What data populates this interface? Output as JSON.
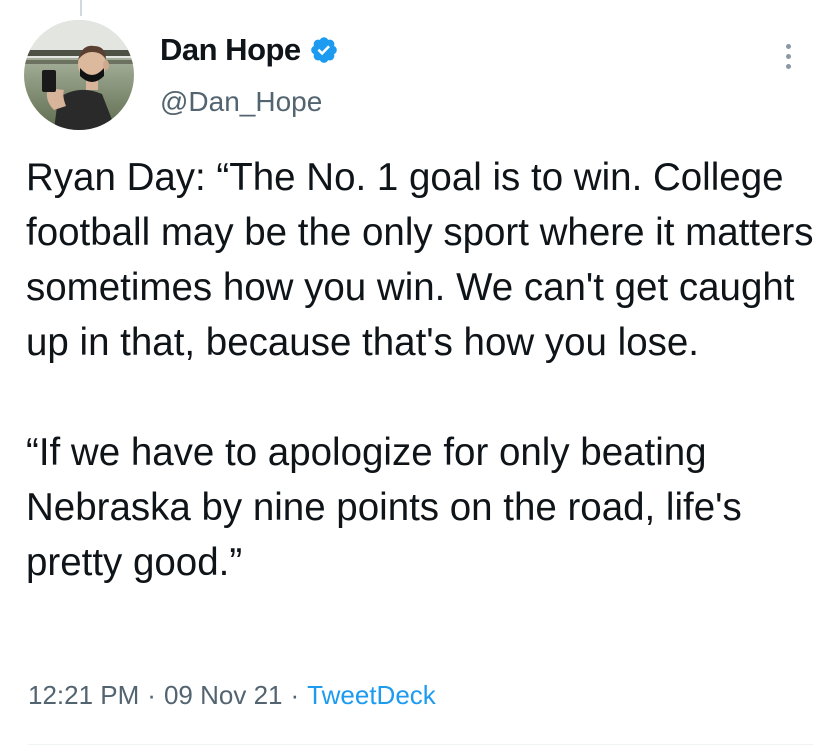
{
  "author": {
    "display_name": "Dan Hope",
    "handle": "@Dan_Hope",
    "verified": true,
    "verified_color": "#1d9bf0"
  },
  "tweet": {
    "paragraph_1": "Ryan Day: “The No. 1 goal is to win. College football may be the only sport where it matters sometimes how you win. We can't get caught up in that, because that's how you lose.",
    "paragraph_2": "“If we have to apologize for only beating Nebraska by nine points on the road, life's pretty good.”"
  },
  "meta": {
    "time": "12:21 PM",
    "separator": "·",
    "date": "09 Nov 21",
    "source": "TweetDeck"
  },
  "icons": {
    "avatar": "avatar-photo",
    "verified": "verified-badge-icon",
    "more": "more-options-icon"
  },
  "colors": {
    "text": "#0f1419",
    "secondary": "#536471",
    "link": "#1d9bf0"
  }
}
